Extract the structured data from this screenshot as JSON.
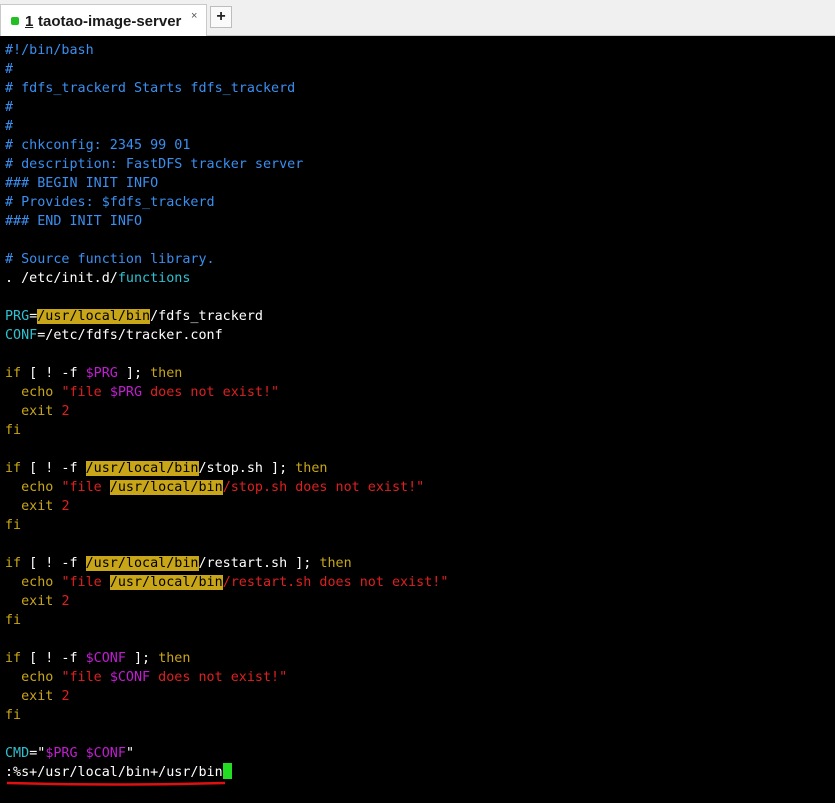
{
  "tab": {
    "number": "1",
    "title": "taotao-image-server",
    "close": "×",
    "new_tab": "+"
  },
  "lines": [
    "#!/bin/bash",
    "#",
    "# fdfs_trackerd Starts fdfs_trackerd",
    "#",
    "#",
    "# chkconfig: 2345 99 01",
    "# description: FastDFS tracker server",
    "### BEGIN INIT INFO",
    "# Provides: $fdfs_trackerd",
    "### END INIT INFO",
    "",
    "# Source function library.",
    ". /etc/init.d/functions",
    "",
    "PRG=/usr/local/bin/fdfs_trackerd",
    "CONF=/etc/fdfs/tracker.conf",
    "",
    "if [ ! -f $PRG ]; then",
    "  echo \"file $PRG does not exist!\"",
    "  exit 2",
    "fi",
    "",
    "if [ ! -f /usr/local/bin/stop.sh ]; then",
    "  echo \"file /usr/local/bin/stop.sh does not exist!\"",
    "  exit 2",
    "fi",
    "",
    "if [ ! -f /usr/local/bin/restart.sh ]; then",
    "  echo \"file /usr/local/bin/restart.sh does not exist!\"",
    "  exit 2",
    "fi",
    "",
    "if [ ! -f $CONF ]; then",
    "  echo \"file $CONF does not exist!\"",
    "  exit 2",
    "fi",
    "",
    "CMD=\"$PRG $CONF\""
  ],
  "command_line": ":%s+/usr/local/bin+/usr/bin",
  "search_highlight": "/usr/local/bin",
  "colors": {
    "comment": "#3a8ff0",
    "keyword": "#c8a618",
    "variable": "#c01ed0",
    "string": "#dd2020",
    "identifier": "#30c0d0",
    "cursor": "#22dd22",
    "annotation_underline": "#e01010"
  }
}
